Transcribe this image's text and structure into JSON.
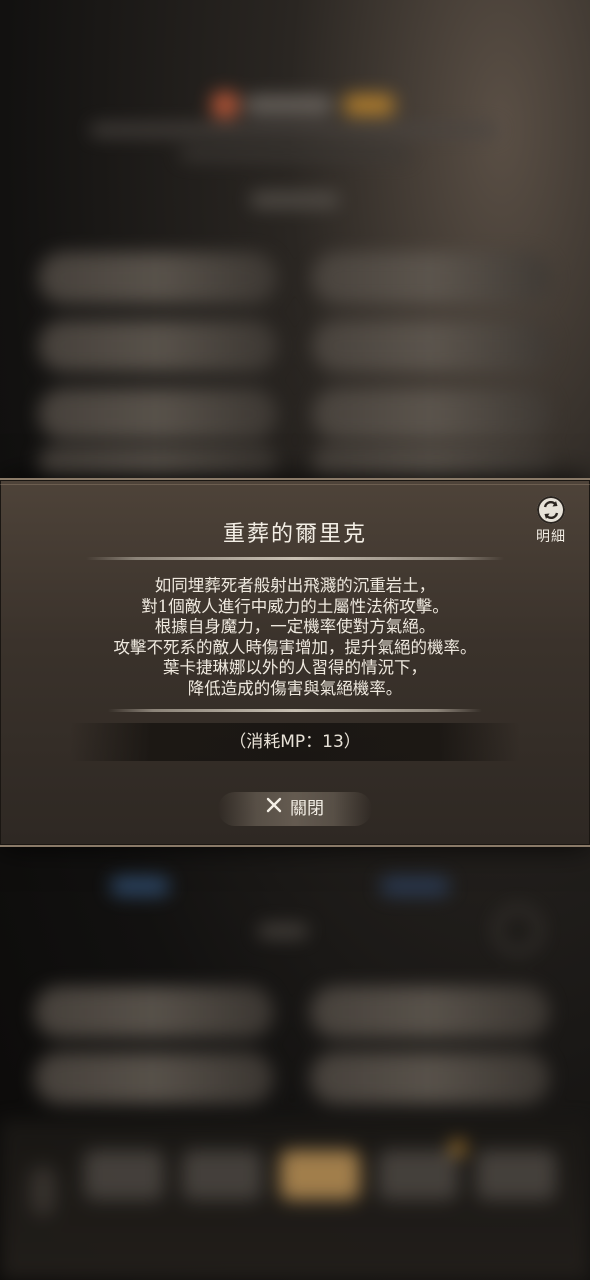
{
  "dialog": {
    "title": "重葬的爾里克",
    "detail_label": "明細",
    "description_lines": [
      "如同埋葬死者般射出飛濺的沉重岩土，",
      "對1個敵人進行中威力的土屬性法術攻擊。",
      "根據自身魔力，一定機率使對方氣絕。",
      "攻擊不死系的敵人時傷害增加，提升氣絕的機率。",
      "葉卡捷琳娜以外的人習得的情況下，",
      "降低造成的傷害與氣絕機率。"
    ],
    "mp_cost": "（消耗MP：13）",
    "close_label": "關閉"
  },
  "icons": {
    "detail": "swap-icon",
    "close": "close-icon"
  },
  "colors": {
    "panel_top": "#4e4339",
    "panel_bottom": "#2e2823",
    "text": "#efe9df",
    "border": "#8a7a68"
  }
}
